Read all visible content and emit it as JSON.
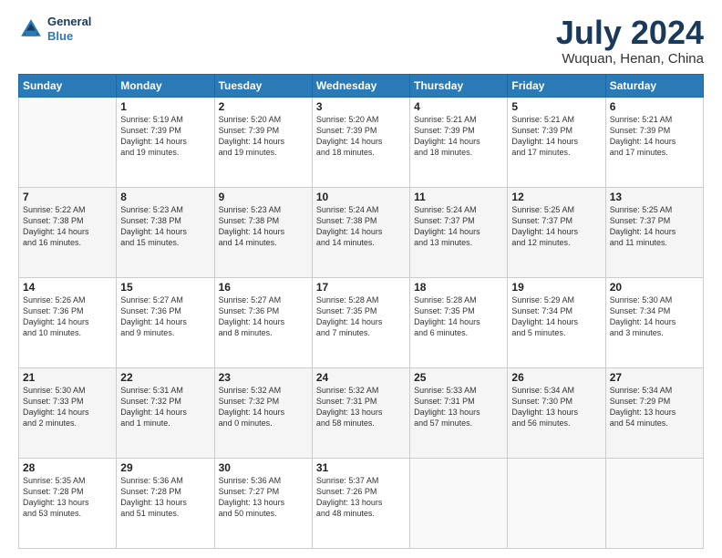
{
  "logo": {
    "line1": "General",
    "line2": "Blue"
  },
  "title": "July 2024",
  "subtitle": "Wuquan, Henan, China",
  "days_header": [
    "Sunday",
    "Monday",
    "Tuesday",
    "Wednesday",
    "Thursday",
    "Friday",
    "Saturday"
  ],
  "weeks": [
    [
      {
        "day": "",
        "info": ""
      },
      {
        "day": "1",
        "info": "Sunrise: 5:19 AM\nSunset: 7:39 PM\nDaylight: 14 hours\nand 19 minutes."
      },
      {
        "day": "2",
        "info": "Sunrise: 5:20 AM\nSunset: 7:39 PM\nDaylight: 14 hours\nand 19 minutes."
      },
      {
        "day": "3",
        "info": "Sunrise: 5:20 AM\nSunset: 7:39 PM\nDaylight: 14 hours\nand 18 minutes."
      },
      {
        "day": "4",
        "info": "Sunrise: 5:21 AM\nSunset: 7:39 PM\nDaylight: 14 hours\nand 18 minutes."
      },
      {
        "day": "5",
        "info": "Sunrise: 5:21 AM\nSunset: 7:39 PM\nDaylight: 14 hours\nand 17 minutes."
      },
      {
        "day": "6",
        "info": "Sunrise: 5:21 AM\nSunset: 7:39 PM\nDaylight: 14 hours\nand 17 minutes."
      }
    ],
    [
      {
        "day": "7",
        "info": "Sunrise: 5:22 AM\nSunset: 7:38 PM\nDaylight: 14 hours\nand 16 minutes."
      },
      {
        "day": "8",
        "info": "Sunrise: 5:23 AM\nSunset: 7:38 PM\nDaylight: 14 hours\nand 15 minutes."
      },
      {
        "day": "9",
        "info": "Sunrise: 5:23 AM\nSunset: 7:38 PM\nDaylight: 14 hours\nand 14 minutes."
      },
      {
        "day": "10",
        "info": "Sunrise: 5:24 AM\nSunset: 7:38 PM\nDaylight: 14 hours\nand 14 minutes."
      },
      {
        "day": "11",
        "info": "Sunrise: 5:24 AM\nSunset: 7:37 PM\nDaylight: 14 hours\nand 13 minutes."
      },
      {
        "day": "12",
        "info": "Sunrise: 5:25 AM\nSunset: 7:37 PM\nDaylight: 14 hours\nand 12 minutes."
      },
      {
        "day": "13",
        "info": "Sunrise: 5:25 AM\nSunset: 7:37 PM\nDaylight: 14 hours\nand 11 minutes."
      }
    ],
    [
      {
        "day": "14",
        "info": "Sunrise: 5:26 AM\nSunset: 7:36 PM\nDaylight: 14 hours\nand 10 minutes."
      },
      {
        "day": "15",
        "info": "Sunrise: 5:27 AM\nSunset: 7:36 PM\nDaylight: 14 hours\nand 9 minutes."
      },
      {
        "day": "16",
        "info": "Sunrise: 5:27 AM\nSunset: 7:36 PM\nDaylight: 14 hours\nand 8 minutes."
      },
      {
        "day": "17",
        "info": "Sunrise: 5:28 AM\nSunset: 7:35 PM\nDaylight: 14 hours\nand 7 minutes."
      },
      {
        "day": "18",
        "info": "Sunrise: 5:28 AM\nSunset: 7:35 PM\nDaylight: 14 hours\nand 6 minutes."
      },
      {
        "day": "19",
        "info": "Sunrise: 5:29 AM\nSunset: 7:34 PM\nDaylight: 14 hours\nand 5 minutes."
      },
      {
        "day": "20",
        "info": "Sunrise: 5:30 AM\nSunset: 7:34 PM\nDaylight: 14 hours\nand 3 minutes."
      }
    ],
    [
      {
        "day": "21",
        "info": "Sunrise: 5:30 AM\nSunset: 7:33 PM\nDaylight: 14 hours\nand 2 minutes."
      },
      {
        "day": "22",
        "info": "Sunrise: 5:31 AM\nSunset: 7:32 PM\nDaylight: 14 hours\nand 1 minute."
      },
      {
        "day": "23",
        "info": "Sunrise: 5:32 AM\nSunset: 7:32 PM\nDaylight: 14 hours\nand 0 minutes."
      },
      {
        "day": "24",
        "info": "Sunrise: 5:32 AM\nSunset: 7:31 PM\nDaylight: 13 hours\nand 58 minutes."
      },
      {
        "day": "25",
        "info": "Sunrise: 5:33 AM\nSunset: 7:31 PM\nDaylight: 13 hours\nand 57 minutes."
      },
      {
        "day": "26",
        "info": "Sunrise: 5:34 AM\nSunset: 7:30 PM\nDaylight: 13 hours\nand 56 minutes."
      },
      {
        "day": "27",
        "info": "Sunrise: 5:34 AM\nSunset: 7:29 PM\nDaylight: 13 hours\nand 54 minutes."
      }
    ],
    [
      {
        "day": "28",
        "info": "Sunrise: 5:35 AM\nSunset: 7:28 PM\nDaylight: 13 hours\nand 53 minutes."
      },
      {
        "day": "29",
        "info": "Sunrise: 5:36 AM\nSunset: 7:28 PM\nDaylight: 13 hours\nand 51 minutes."
      },
      {
        "day": "30",
        "info": "Sunrise: 5:36 AM\nSunset: 7:27 PM\nDaylight: 13 hours\nand 50 minutes."
      },
      {
        "day": "31",
        "info": "Sunrise: 5:37 AM\nSunset: 7:26 PM\nDaylight: 13 hours\nand 48 minutes."
      },
      {
        "day": "",
        "info": ""
      },
      {
        "day": "",
        "info": ""
      },
      {
        "day": "",
        "info": ""
      }
    ]
  ]
}
